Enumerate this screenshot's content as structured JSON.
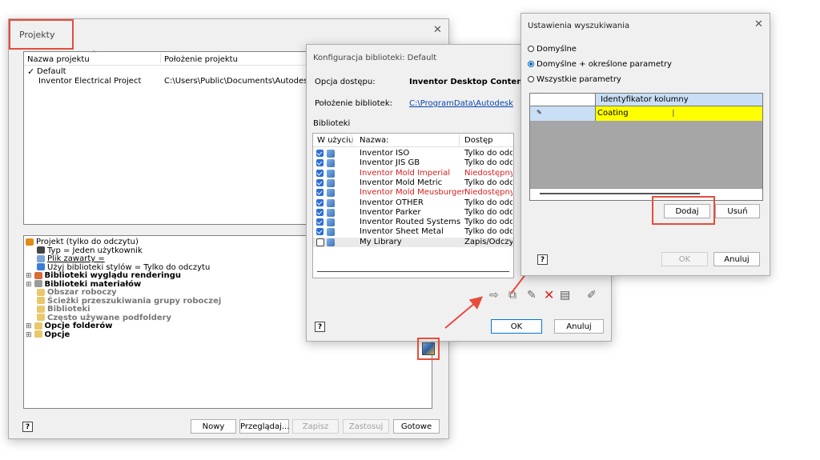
{
  "projekty": {
    "title": "Projekty",
    "columns": [
      "Nazwa projektu",
      "Położenie projektu"
    ],
    "projects": [
      {
        "check": "✓",
        "name": "Default",
        "path": ""
      },
      {
        "check": "",
        "name": "Inventor Electrical Project",
        "path": "C:\\Users\\Public\\Documents\\Autodesk\\In"
      }
    ],
    "tree": [
      {
        "label": "Projekt (tylko do odczytu)",
        "bold": false,
        "gray": false,
        "expander": "",
        "icon": "project-icon",
        "indent": 0
      },
      {
        "label": "Typ = Jeden użytkownik",
        "bold": false,
        "gray": false,
        "expander": "",
        "icon": "user-icon",
        "indent": 1
      },
      {
        "label": "Plik zawarty = ",
        "bold": false,
        "gray": false,
        "expander": "",
        "icon": "file-icon",
        "indent": 1,
        "underline": true
      },
      {
        "label": "Użyj biblioteki stylów = Tylko do odczytu",
        "bold": false,
        "gray": false,
        "expander": "",
        "icon": "style-icon",
        "indent": 1
      },
      {
        "label": "Biblioteki wyglądu renderingu",
        "bold": true,
        "gray": false,
        "expander": "⊞",
        "icon": "render-icon",
        "indent": 0
      },
      {
        "label": "Biblioteki materiałów",
        "bold": true,
        "gray": false,
        "expander": "⊞",
        "icon": "material-icon",
        "indent": 0
      },
      {
        "label": "Obszar roboczy",
        "bold": true,
        "gray": true,
        "expander": "",
        "icon": "folder-icon",
        "indent": 1
      },
      {
        "label": "Ścieżki przeszukiwania grupy roboczej",
        "bold": true,
        "gray": true,
        "expander": "",
        "icon": "folder-icon",
        "indent": 1
      },
      {
        "label": "Biblioteki",
        "bold": true,
        "gray": true,
        "expander": "",
        "icon": "folder-icon",
        "indent": 1
      },
      {
        "label": "Często używane podfoldery",
        "bold": true,
        "gray": true,
        "expander": "",
        "icon": "folder-icon",
        "indent": 1
      },
      {
        "label": "Opcje folderów",
        "bold": true,
        "gray": false,
        "expander": "⊞",
        "icon": "folder-icon",
        "indent": 0
      },
      {
        "label": "Opcje",
        "bold": true,
        "gray": false,
        "expander": "⊞",
        "icon": "folder-icon",
        "indent": 0
      }
    ],
    "buttons": {
      "new": "Nowy",
      "browse": "Przeglądaj...",
      "save": "Zapisz",
      "apply": "Zastosuj",
      "done": "Gotowe"
    }
  },
  "konfig": {
    "title": "Konfiguracja biblioteki: Default",
    "access_label": "Opcja dostępu:",
    "access_value": "Inventor Desktop Content",
    "location_label": "Położenie bibliotek:",
    "location_value": "C:\\ProgramData\\Autodesk\\Inve",
    "section": "Biblioteki",
    "columns": [
      "W użyciu",
      "Nazwa:",
      "Dostęp"
    ],
    "libraries": [
      {
        "checked": true,
        "name": "Inventor ISO",
        "access": "Tylko do odczytu",
        "red": false
      },
      {
        "checked": true,
        "name": "Inventor JIS GB",
        "access": "Tylko do odczytu",
        "red": false
      },
      {
        "checked": true,
        "name": "Inventor Mold Imperial",
        "access": "Niedostępny",
        "red": true
      },
      {
        "checked": true,
        "name": "Inventor Mold Metric",
        "access": "Tylko do odczytu",
        "red": false
      },
      {
        "checked": true,
        "name": "Inventor Mold Meusburger",
        "access": "Niedostępny",
        "red": true
      },
      {
        "checked": true,
        "name": "Inventor OTHER",
        "access": "Tylko do odczytu",
        "red": false
      },
      {
        "checked": true,
        "name": "Inventor Parker",
        "access": "Tylko do odczytu",
        "red": false
      },
      {
        "checked": true,
        "name": "Inventor Routed Systems",
        "access": "Tylko do odczytu",
        "red": false
      },
      {
        "checked": true,
        "name": "Inventor Sheet Metal",
        "access": "Tylko do odczytu",
        "red": false
      },
      {
        "checked": false,
        "name": "My Library",
        "access": "Zapis/Odczyt",
        "red": false
      }
    ],
    "buttons": {
      "ok": "OK",
      "cancel": "Anuluj"
    }
  },
  "ustawienia": {
    "title": "Ustawienia wyszukiwania",
    "options": [
      {
        "label": "Domyślne",
        "selected": false
      },
      {
        "label": "Domyślne + określone parametry",
        "selected": true
      },
      {
        "label": "Wszystkie parametry",
        "selected": false
      }
    ],
    "grid_header": "Identyfikator kolumny",
    "grid_value": "Coating",
    "buttons": {
      "add": "Dodaj",
      "remove": "Usuń",
      "ok": "OK",
      "cancel": "Anuluj"
    }
  },
  "colors": {
    "highlight": "#e74c3c",
    "link": "#0645ad",
    "red_text": "#d42020",
    "grid_yellow": "#ffff00",
    "grid_blue": "#c9dff5"
  }
}
